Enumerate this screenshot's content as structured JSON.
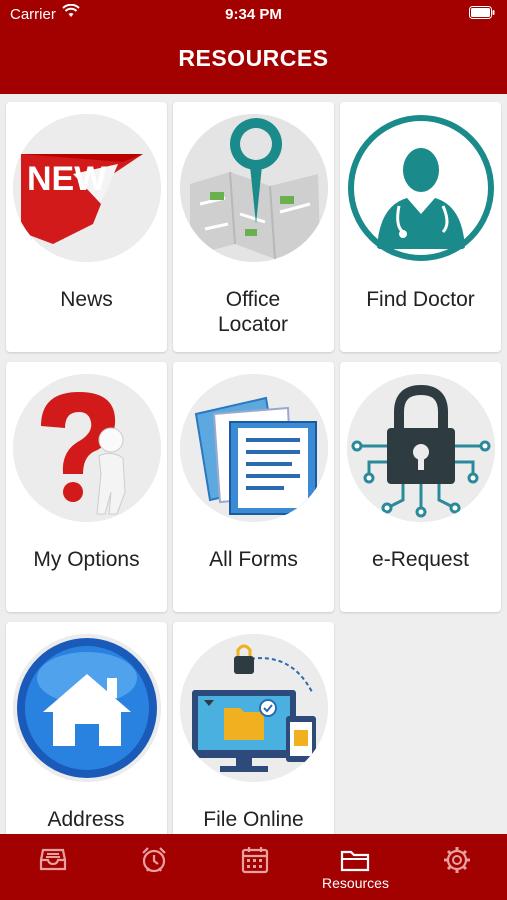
{
  "status": {
    "carrier": "Carrier",
    "time": "9:34 PM"
  },
  "header": {
    "title": "RESOURCES"
  },
  "tiles": [
    {
      "label": "News",
      "icon": "news-icon"
    },
    {
      "label": "Office Locator",
      "icon": "map-pin-icon"
    },
    {
      "label": "Find Doctor",
      "icon": "doctor-icon"
    },
    {
      "label": "My Options",
      "icon": "question-mark-icon"
    },
    {
      "label": "All Forms",
      "icon": "documents-icon"
    },
    {
      "label": "e-Request",
      "icon": "lock-circuit-icon"
    },
    {
      "label": "Address Change",
      "icon": "home-icon"
    },
    {
      "label": "File Online",
      "icon": "computer-files-icon"
    }
  ],
  "tabbar": {
    "items": [
      {
        "label": "",
        "icon": "inbox-icon"
      },
      {
        "label": "",
        "icon": "alarm-clock-icon"
      },
      {
        "label": "",
        "icon": "calendar-icon"
      },
      {
        "label": "Resources",
        "icon": "folder-icon",
        "active": true
      },
      {
        "label": "",
        "icon": "gear-icon"
      }
    ]
  },
  "colors": {
    "brand": "#a30000",
    "background": "#eeeeee",
    "teal": "#1a8a8a"
  }
}
